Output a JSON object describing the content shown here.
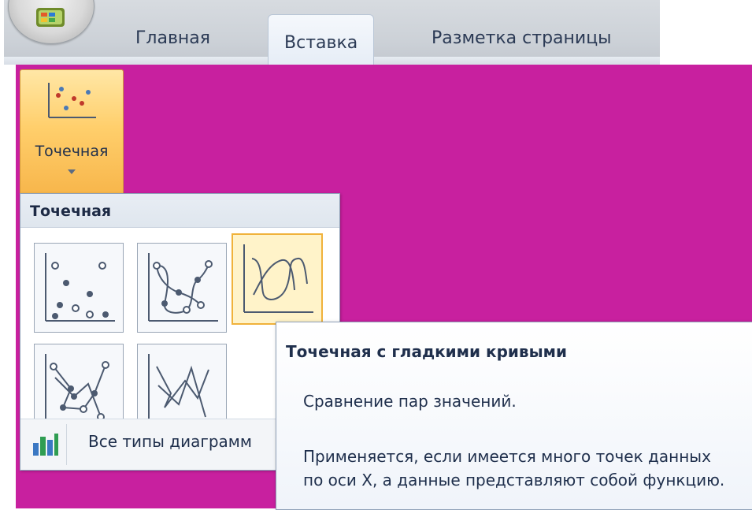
{
  "ribbon": {
    "tabs": [
      {
        "label": "Главная"
      },
      {
        "label": "Вставка",
        "active": true
      },
      {
        "label": "Разметка страницы"
      }
    ]
  },
  "chart_button": {
    "label": "Точечная",
    "icon": "scatter-chart-icon"
  },
  "gallery": {
    "header": "Точечная",
    "items": [
      {
        "icon": "scatter-markers-only-icon"
      },
      {
        "icon": "scatter-smooth-lines-markers-icon"
      },
      {
        "icon": "scatter-smooth-lines-icon",
        "hovered": true
      },
      {
        "icon": "scatter-straight-lines-markers-icon"
      },
      {
        "icon": "scatter-straight-lines-icon"
      }
    ],
    "footer": {
      "icon": "bar-chart-icon",
      "label": "Все типы диаграмм"
    }
  },
  "tooltip": {
    "title": "Точечная с гладкими кривыми",
    "line1": "Сравнение пар значений.",
    "line2": "Применяется, если имеется много точек данных по оси X, а данные представляют собой функцию."
  },
  "colors": {
    "background_magenta": "#c8209f",
    "hover_border": "#f0b23b",
    "hover_fill": "#fff3c9",
    "text": "#1f2f4c"
  }
}
